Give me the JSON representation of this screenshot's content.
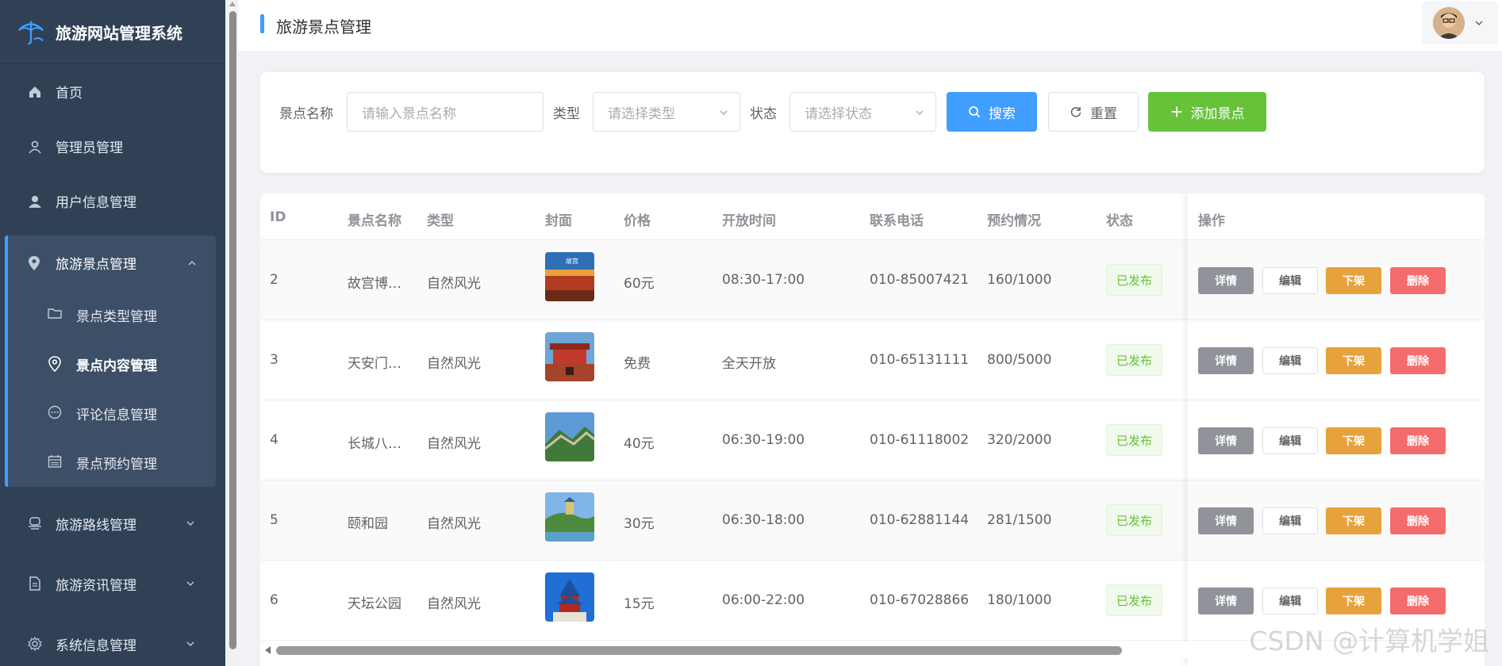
{
  "app": {
    "title": "旅游网站管理系统"
  },
  "sidebar": {
    "items": [
      {
        "label": "首页",
        "icon": "home-icon"
      },
      {
        "label": "管理员管理",
        "icon": "user-outline-icon"
      },
      {
        "label": "用户信息管理",
        "icon": "user-filled-icon"
      }
    ],
    "expanded": {
      "label": "旅游景点管理",
      "icon": "location-icon",
      "children": [
        {
          "label": "景点类型管理",
          "icon": "folder-icon"
        },
        {
          "label": "景点内容管理",
          "icon": "location-icon",
          "active": true
        },
        {
          "label": "评论信息管理",
          "icon": "comment-icon"
        },
        {
          "label": "景点预约管理",
          "icon": "calendar-icon"
        }
      ]
    },
    "collapsed": [
      {
        "label": "旅游路线管理",
        "icon": "route-icon"
      },
      {
        "label": "旅游资讯管理",
        "icon": "document-icon"
      },
      {
        "label": "系统信息管理",
        "icon": "gear-icon"
      }
    ]
  },
  "header": {
    "title": "旅游景点管理"
  },
  "filter": {
    "name_label": "景点名称",
    "name_placeholder": "请输入景点名称",
    "type_label": "类型",
    "type_placeholder": "请选择类型",
    "status_label": "状态",
    "status_placeholder": "请选择状态",
    "search_label": "搜索",
    "reset_label": "重置",
    "add_label": "添加景点"
  },
  "table": {
    "columns": [
      "ID",
      "景点名称",
      "类型",
      "封面",
      "价格",
      "开放时间",
      "联系电话",
      "预约情况",
      "状态",
      "操作"
    ],
    "rows": [
      {
        "id": "2",
        "name": "故宫博…",
        "type": "自然风光",
        "price": "60元",
        "hours": "08:30-17:00",
        "phone": "010-85007421",
        "booking": "160/1000",
        "status": "已发布"
      },
      {
        "id": "3",
        "name": "天安门…",
        "type": "自然风光",
        "price": "免费",
        "hours": "全天开放",
        "phone": "010-65131111",
        "booking": "800/5000",
        "status": "已发布"
      },
      {
        "id": "4",
        "name": "长城八…",
        "type": "自然风光",
        "price": "40元",
        "hours": "06:30-19:00",
        "phone": "010-61118002",
        "booking": "320/2000",
        "status": "已发布"
      },
      {
        "id": "5",
        "name": "颐和园",
        "type": "自然风光",
        "price": "30元",
        "hours": "06:30-18:00",
        "phone": "010-62881144",
        "booking": "281/1500",
        "status": "已发布"
      },
      {
        "id": "6",
        "name": "天坛公园",
        "type": "自然风光",
        "price": "15元",
        "hours": "06:00-22:00",
        "phone": "010-67028866",
        "booking": "180/1000",
        "status": "已发布"
      }
    ],
    "actions": {
      "detail": "详情",
      "edit": "编辑",
      "off": "下架",
      "delete": "删除"
    }
  },
  "watermark": "CSDN @计算机学姐",
  "colors": {
    "primary": "#409eff",
    "success": "#67c23a",
    "warning": "#e6a23c",
    "danger": "#f56c6c",
    "info": "#909399",
    "sidebar": "#304156"
  }
}
